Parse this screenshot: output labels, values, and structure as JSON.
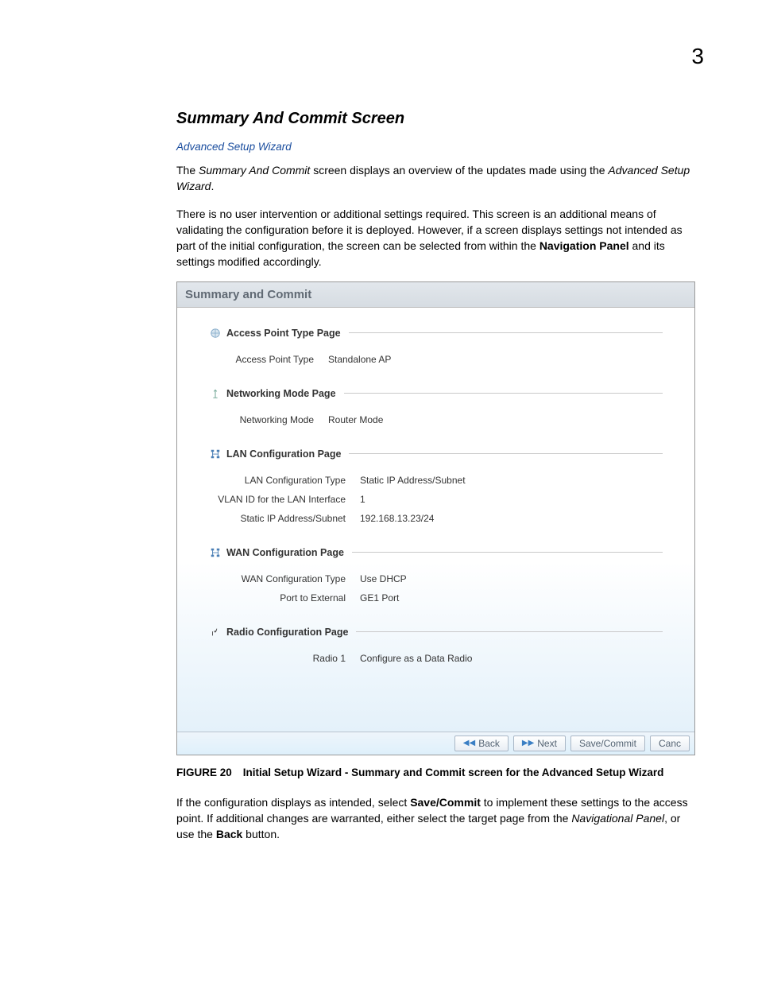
{
  "page_number": "3",
  "title": "Summary And Commit Screen",
  "breadcrumb": "Advanced Setup Wizard",
  "para1_a": "The ",
  "para1_b": "Summary And Commit",
  "para1_c": " screen displays an overview of the updates made using the ",
  "para1_d": "Advanced Setup Wizard",
  "para1_e": ".",
  "para2_a": "There is no user intervention or additional settings required. This screen is an additional means of validating the configuration before it is deployed. However, if a screen displays settings not intended as part of the initial configuration, the screen can be selected from within the ",
  "para2_b": "Navigation Panel",
  "para2_c": " and its settings modified accordingly.",
  "screenshot": {
    "header": "Summary and Commit",
    "groups": {
      "ap_type": {
        "title": "Access Point Type Page",
        "row1_k": "Access Point Type",
        "row1_v": "Standalone AP"
      },
      "net_mode": {
        "title": "Networking Mode Page",
        "row1_k": "Networking Mode",
        "row1_v": "Router Mode"
      },
      "lan": {
        "title": "LAN Configuration Page",
        "row1_k": "LAN Configuration Type",
        "row1_v": "Static IP Address/Subnet",
        "row2_k": "VLAN ID for the LAN Interface",
        "row2_v": "1",
        "row3_k": "Static IP Address/Subnet",
        "row3_v": "192.168.13.23/24"
      },
      "wan": {
        "title": "WAN Configuration Page",
        "row1_k": "WAN Configuration Type",
        "row1_v": "Use DHCP",
        "row2_k": "Port to External",
        "row2_v": "GE1 Port"
      },
      "radio": {
        "title": "Radio Configuration Page",
        "row1_k": "Radio 1",
        "row1_v": "Configure as a Data Radio"
      }
    },
    "buttons": {
      "back": "Back",
      "next": "Next",
      "save": "Save/Commit",
      "cancel": "Canc"
    }
  },
  "figure_label": "FIGURE 20",
  "figure_text": "Initial Setup Wizard - Summary and Commit screen for the Advanced Setup Wizard",
  "para3_a": "If the configuration displays as intended, select ",
  "para3_b": "Save/Commit",
  "para3_c": " to implement these settings to the access point. If additional changes are warranted, either select the target page from the ",
  "para3_d": "Navigational Panel",
  "para3_e": ", or use the ",
  "para3_f": "Back",
  "para3_g": " button."
}
